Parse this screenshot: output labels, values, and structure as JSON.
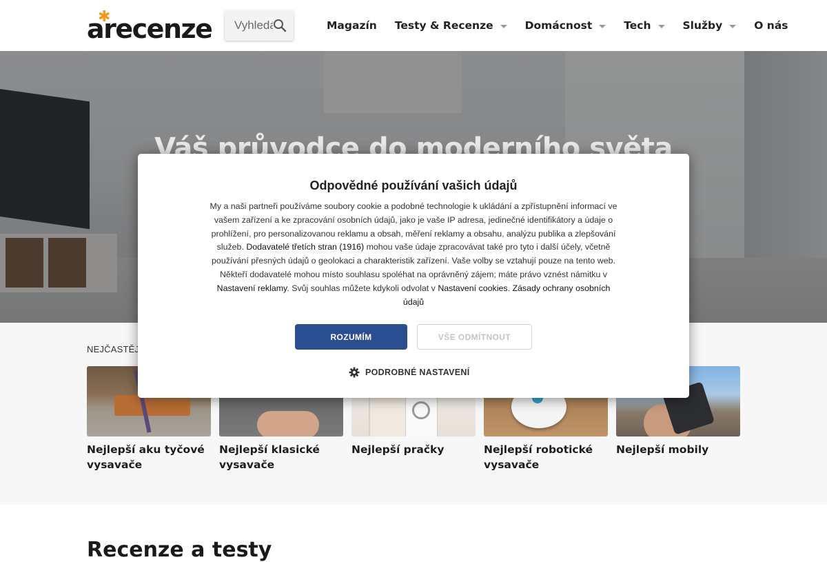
{
  "header": {
    "logo": "arecenze",
    "search": {
      "placeholder": "Vyhledávání"
    },
    "nav": [
      {
        "label": "Magazín",
        "dropdown": false
      },
      {
        "label": "Testy & Recenze",
        "dropdown": true
      },
      {
        "label": "Domácnost",
        "dropdown": true
      },
      {
        "label": "Tech",
        "dropdown": true
      },
      {
        "label": "Služby",
        "dropdown": true
      },
      {
        "label": "O nás",
        "dropdown": false
      }
    ]
  },
  "hero": {
    "title": "Váš průvodce do moderního světa"
  },
  "popular": {
    "label": "NEJČASTĚJI P",
    "cards": [
      {
        "title": "Nejlepší aku tyčové vysavače",
        "image": "cordless-vacuum-photo"
      },
      {
        "title": "Nejlepší klasické vysavače",
        "image": "canister-vacuum-photo"
      },
      {
        "title": "Nejlepší pračky",
        "image": "washing-machine-photo"
      },
      {
        "title": "Nejlepší robotické vysavače",
        "image": "robot-vacuum-photo"
      },
      {
        "title": "Nejlepší mobily",
        "image": "smartphone-photo"
      }
    ]
  },
  "reviews": {
    "title": "Recenze a testy"
  },
  "consent": {
    "title": "Odpovědné používání vašich údajů",
    "body": {
      "t1": "My a naši partneři používáme soubory cookie a podobné technologie k ukládání a zpřístupnění informací ve vašem zařízení a ke zpracování osobních údajů, jako je vaše IP adresa, jedinečné identifikátory a údaje o prohlížení, pro personalizovanou reklamu a obsah, měření reklamy a obsahu, analýzu publika a zlepšování služeb. ",
      "link_vendors": "Dodavatelé třetích stran (1916)",
      "t2": " mohou vaše údaje zpracovávat také pro tyto i další účely, včetně používání přesných údajů o geolokaci a charakteristik zařízení. Vaše volby se vztahují pouze na tento web. Někteří dodavatelé mohou místo souhlasu spoléhat na oprávněný zájem; máte právo vznést námitku v ",
      "link_ads": "Nastavení reklamy",
      "t3": ". Svůj souhlas můžete kdykoli odvolat v ",
      "link_cookies": "Nastavení cookies",
      "t4": ". ",
      "link_privacy": "Zásady ochrany osobních údajů"
    },
    "accept": "ROZUMÍM",
    "reject": "VŠE ODMÍTNOUT",
    "settings": "PODROBNÉ NASTAVENÍ"
  },
  "colors": {
    "accent": "#2b4e91",
    "logo_star": "#f29a1f"
  }
}
